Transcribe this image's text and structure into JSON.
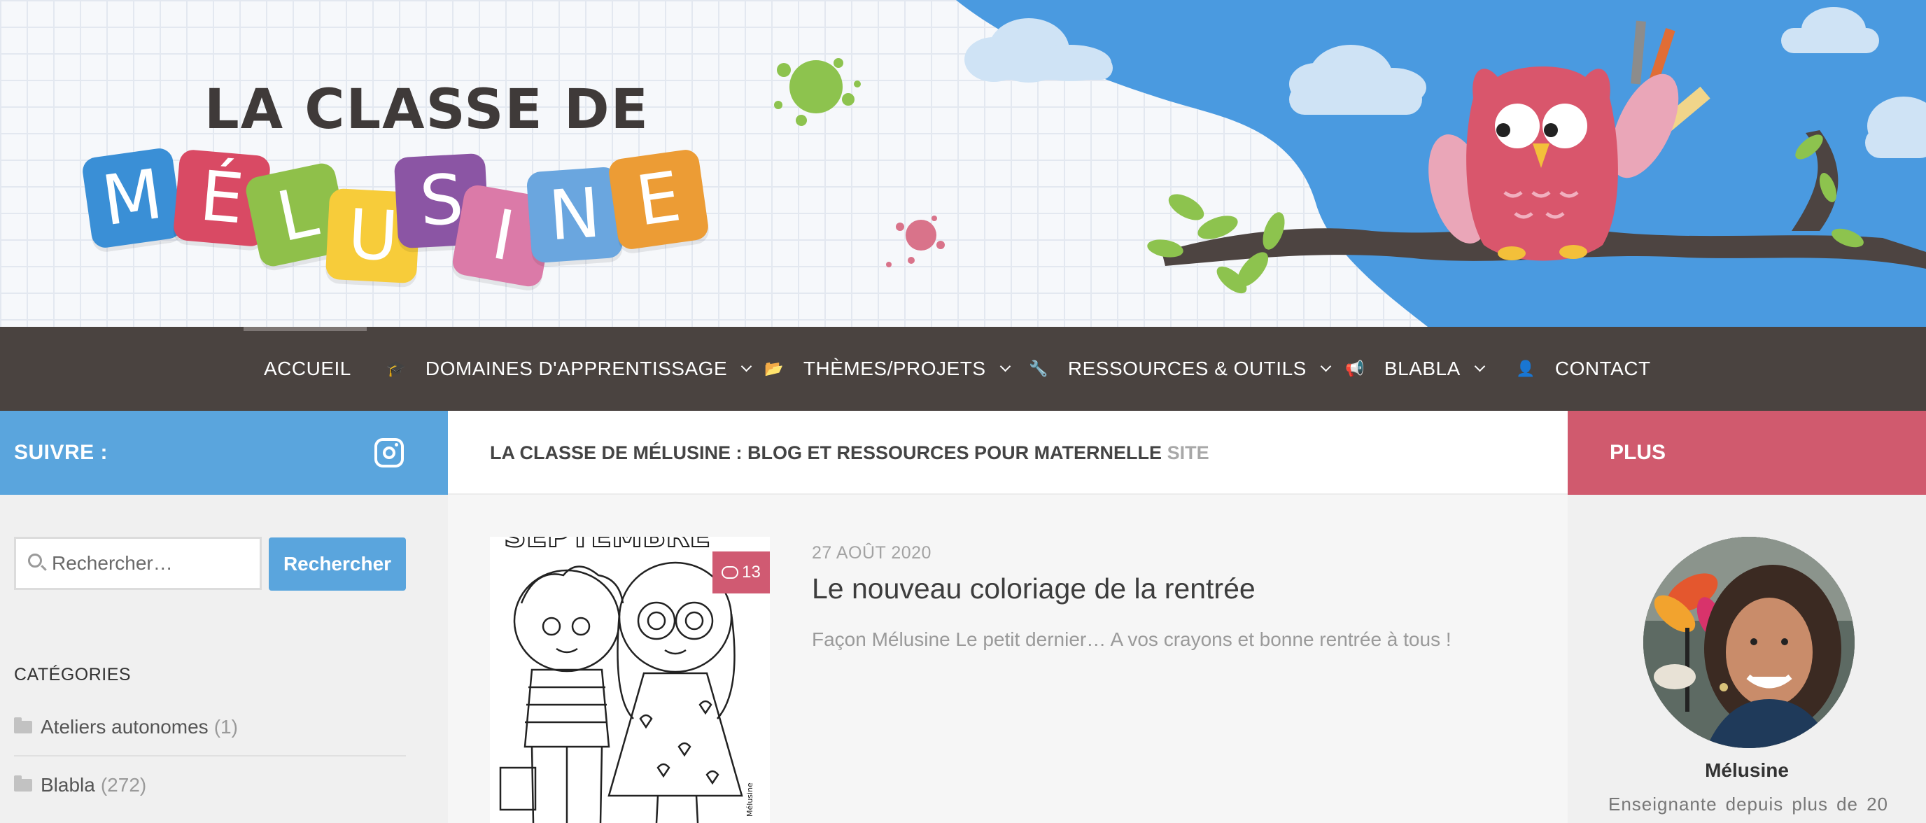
{
  "header": {
    "logo_top": "LA CLASSE DE",
    "logo_letters": [
      "M",
      "É",
      "L",
      "U",
      "S",
      "I",
      "N",
      "E"
    ],
    "tile_colors": [
      "#3a8fd6",
      "#d94a64",
      "#8fc04a",
      "#f7cc3a",
      "#8b55a4",
      "#db7aa8",
      "#6aa6df",
      "#ec9c35"
    ]
  },
  "nav": {
    "items": [
      {
        "label": "ACCUEIL",
        "icon": "",
        "dropdown": false
      },
      {
        "label": "DOMAINES D'APPRENTISSAGE",
        "icon": "graduation-cap-icon",
        "dropdown": true
      },
      {
        "label": "THÈMES/PROJETS",
        "icon": "folder-open-icon",
        "dropdown": true
      },
      {
        "label": "RESSOURCES & OUTILS",
        "icon": "wrench-icon",
        "dropdown": true
      },
      {
        "label": "BLABLA",
        "icon": "megaphone-icon",
        "dropdown": true
      },
      {
        "label": "CONTACT",
        "icon": "user-icon",
        "dropdown": false
      }
    ],
    "active_index": 0
  },
  "left_sidebar": {
    "follow_label": "SUIVRE :",
    "follow_icon": "instagram-icon",
    "search_placeholder": "Rechercher…",
    "search_button": "Rechercher",
    "categories_title": "CATÉGORIES",
    "categories": [
      {
        "name": "Ateliers autonomes",
        "count": "(1)"
      },
      {
        "name": "Blabla",
        "count": "(272)"
      }
    ]
  },
  "main": {
    "heading": "LA CLASSE DE MÉLUSINE : BLOG ET RESSOURCES POUR MATERNELLE",
    "heading_suffix": "SITE",
    "post": {
      "date": "27 AOÛT 2020",
      "title": "Le nouveau coloriage de la rentrée",
      "excerpt": "Façon Mélusine Le petit dernier… A vos crayons et bonne rentrée à tous !",
      "comments": "13",
      "thumb_caption": "SEPTEMBRE",
      "thumb_signature": "Mélusine"
    }
  },
  "right_sidebar": {
    "title": "PLUS",
    "author_name": "Mélusine",
    "author_bio": "Enseignante depuis plus de 20"
  },
  "colors": {
    "nav_bg": "#4a4340",
    "follow_bg": "#5aa5dd",
    "plus_bg": "#d05a6e",
    "badge_bg": "#d05a72",
    "sky": "#4a9ae0"
  }
}
